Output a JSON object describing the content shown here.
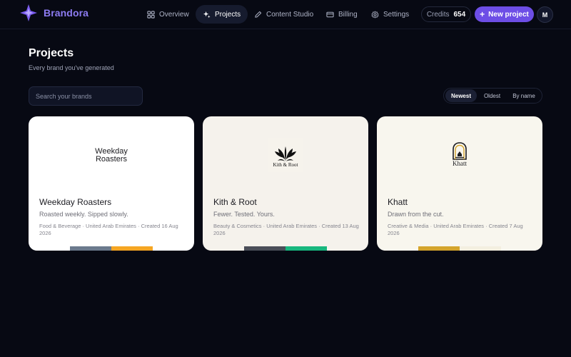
{
  "brand": {
    "name": "Brandora",
    "accent": "#8d7cf2"
  },
  "nav": {
    "items": [
      {
        "label": "Overview",
        "icon": "grid-icon",
        "active": false
      },
      {
        "label": "Projects",
        "icon": "sparkle-icon",
        "active": true
      },
      {
        "label": "Content Studio",
        "icon": "pen-icon",
        "active": false
      },
      {
        "label": "Billing",
        "icon": "card-icon",
        "active": false
      },
      {
        "label": "Settings",
        "icon": "gear-icon",
        "active": false
      }
    ],
    "credits_label": "Credits",
    "credits_value": "654",
    "new_project_label": "New project",
    "avatar_initial": "M"
  },
  "page": {
    "title": "Projects",
    "subtitle": "Every brand you've generated",
    "search_placeholder": "Search your brands",
    "sort": {
      "options": [
        "Newest",
        "Oldest",
        "By name"
      ],
      "active": "Newest"
    }
  },
  "projects": [
    {
      "name": "Weekday Roasters",
      "tagline": "Roasted weekly. Sipped slowly.",
      "meta": "Food & Beverage · United Arab Emirates · Created 16 Aug 2026",
      "logo_text_1": "Weekday",
      "logo_text_2": "Roasters",
      "card_bg": "#ffffff",
      "palette": [
        "#ffffff",
        "#6b7a8d",
        "#f5a623",
        "#ffffff"
      ]
    },
    {
      "name": "Kith & Root",
      "tagline": "Fewer. Tested. Yours.",
      "meta": "Beauty & Cosmetics · United Arab Emirates · Created 13 Aug 2026",
      "logo_text": "Kith & Root",
      "card_bg": "#f5f2ec",
      "palette": [
        "#f5f2ec",
        "#4a4e58",
        "#18b77e",
        "#f5f2ec"
      ]
    },
    {
      "name": "Khatt",
      "tagline": "Drawn from the cut.",
      "meta": "Creative & Media · United Arab Emirates · Created 7 Aug 2026",
      "logo_text": "Khatt",
      "card_bg": "#f8f6ee",
      "palette": [
        "#f8f6ee",
        "#d4a42c",
        "#f3efe0",
        "#f8f6ee"
      ]
    }
  ]
}
